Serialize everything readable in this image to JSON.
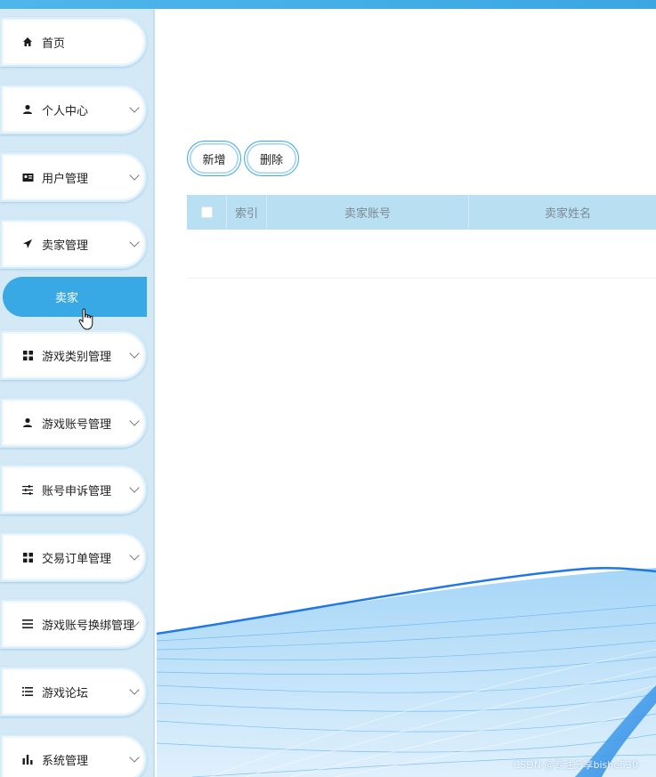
{
  "sidebar": {
    "items": [
      {
        "label": "首页",
        "icon": "home-icon",
        "has_children": false
      },
      {
        "label": "个人中心",
        "icon": "user-icon",
        "has_children": true
      },
      {
        "label": "用户管理",
        "icon": "id-card-icon",
        "has_children": true
      },
      {
        "label": "卖家管理",
        "icon": "paper-plane-icon",
        "has_children": true
      },
      {
        "label": "游戏类别管理",
        "icon": "grid-icon",
        "has_children": true
      },
      {
        "label": "游戏账号管理",
        "icon": "user-icon",
        "has_children": true
      },
      {
        "label": "账号申诉管理",
        "icon": "sliders-icon",
        "has_children": true
      },
      {
        "label": "交易订单管理",
        "icon": "grid-icon",
        "has_children": true
      },
      {
        "label": "游戏账号换绑管理",
        "icon": "list-icon",
        "has_children": true
      },
      {
        "label": "游戏论坛",
        "icon": "list-icon",
        "has_children": true
      },
      {
        "label": "系统管理",
        "icon": "bar-chart-icon",
        "has_children": true
      }
    ],
    "active_sub_item": {
      "label": "卖家",
      "parent": "卖家管理"
    }
  },
  "toolbar": {
    "add_label": "新增",
    "delete_label": "删除"
  },
  "table": {
    "columns": [
      "",
      "索引",
      "卖家账号",
      "卖家姓名"
    ],
    "rows": []
  },
  "watermark": "CSDN @专注分享bishe530",
  "colors": {
    "accent": "#39a9e6",
    "sidebar_bg": "#d3e9f6",
    "table_header_bg": "#b9dff3"
  }
}
